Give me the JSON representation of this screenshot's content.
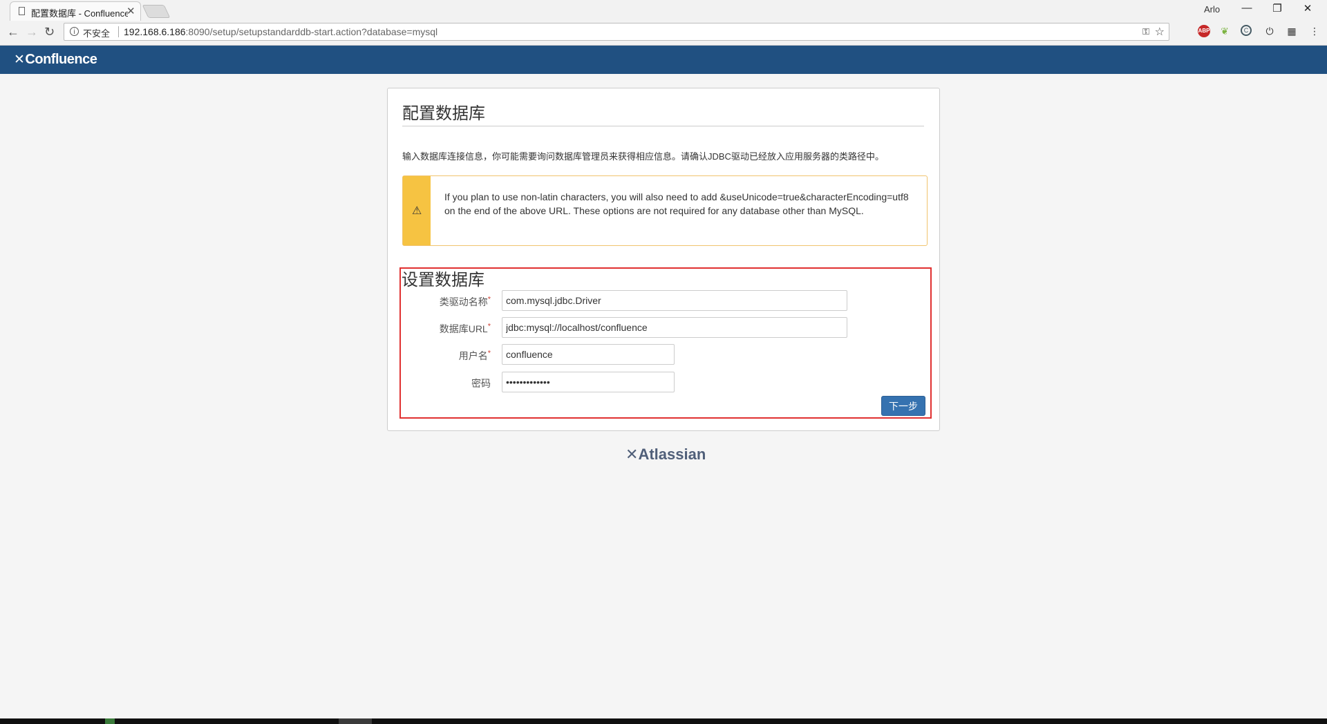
{
  "browser": {
    "tab_title": "配置数据库 - Confluence",
    "user_name": "Arlo",
    "security_label": "不安全",
    "url_host": "192.168.6.186",
    "url_path": ":8090/setup/setupstandarddb-start.action?database=mysql",
    "extensions": [
      "abp-icon",
      "leaf-icon",
      "circle-c-icon",
      "power-icon",
      "qr-icon",
      "menu-icon"
    ]
  },
  "app": {
    "logo_text": "Confluence"
  },
  "page": {
    "title": "配置数据库",
    "intro": "输入数据库连接信息，你可能需要询问数据库管理员来获得相应信息。请确认JDBC驱动已经放入应用服务器的类路径中。",
    "warning": "If you plan to use non-latin characters, you will also need to add &useUnicode=true&characterEncoding=utf8 on the end of the above URL. These options are not required for any database other than MySQL.",
    "section_title": "设置数据库"
  },
  "form": {
    "driver_label": "类驱动名称",
    "driver_value": "com.mysql.jdbc.Driver",
    "url_label": "数据库URL",
    "url_value": "jdbc:mysql://localhost/confluence",
    "user_label": "用户名",
    "user_value": "confluence",
    "password_label": "密码",
    "password_value": "•••••••••••••",
    "required_mark": "*",
    "next_button": "下一步"
  },
  "footer": {
    "brand": "Atlassian"
  },
  "colors": {
    "appbar": "#205081",
    "warning": "#f6c342",
    "button": "#3572b0",
    "highlight": "#e03030"
  }
}
